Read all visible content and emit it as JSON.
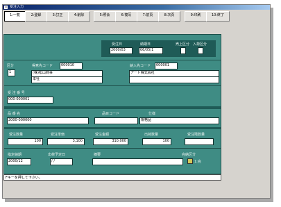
{
  "window": {
    "title": "受注入力"
  },
  "toolbar": {
    "buttons": [
      "1:一覧",
      "2:登録",
      "3:訂正",
      "4:削除",
      "5:照会",
      "6:複写",
      "7:前頁",
      "8:次頁",
      "9:印刷",
      "10:終了"
    ]
  },
  "header": {
    "received_date_label": "受注日",
    "received_date": "2000/03",
    "delivery_date_label": "納期日",
    "delivery_date": "06/05/1",
    "flag1_label": "売上区分",
    "flag2_label": "入荷区分"
  },
  "customer": {
    "no_label": "区分",
    "no_value": "1",
    "customer_label": "得意先コード",
    "customer_code": "000010",
    "customer_name1": "(株)松山商事",
    "customer_name2": "本社",
    "delivery_label": "納入先コード",
    "delivery_code": "000001",
    "delivery_name": "アート株式会社"
  },
  "order": {
    "order_no_label": "受 注 番 号",
    "order_no": "000-000001"
  },
  "item": {
    "product_label": "品 番 名",
    "product_code": "2000-000000",
    "category_label": "品目コード",
    "spec_label": "仕様",
    "spec_value": "規格品"
  },
  "quantities": {
    "qty_label": "受注数量",
    "qty": "100",
    "price_label": "受注単価",
    "price": "3,100",
    "amount_label": "受注金額",
    "amount": "310,000",
    "shipped_label": "出荷数量",
    "shipped": "100",
    "unshipped_label": "受注残数量",
    "unshipped": ""
  },
  "footer_row": {
    "due_label": "指定納期",
    "due_value": "2000/12",
    "ship_date_label": "出荷予定日",
    "ship_date": "/ /",
    "note_label": "摘要",
    "note_value": "",
    "done_label": "完納区分",
    "done_value": "1:完"
  },
  "status": {
    "message": "Fキーを押して下さい。"
  },
  "colors": {
    "panel": "#3f8c84",
    "titlebar": "#0a246a"
  }
}
